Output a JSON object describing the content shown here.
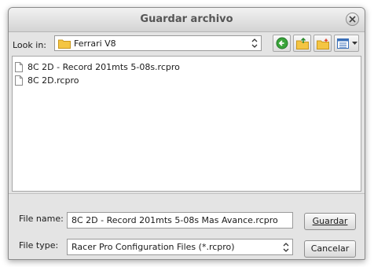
{
  "window": {
    "title": "Guardar archivo"
  },
  "toolbar": {
    "look_in_label": "Look in:",
    "current_folder": "Ferrari V8",
    "buttons": [
      "back-icon",
      "up-folder-icon",
      "new-folder-icon",
      "view-menu-icon"
    ]
  },
  "files": [
    {
      "name": "8C 2D - Record 201mts 5-08s.rcpro"
    },
    {
      "name": "8C 2D.rcpro"
    }
  ],
  "form": {
    "file_name_label": "File name:",
    "file_name_value": "8C 2D - Record 201mts 5-08s Mas Avance.rcpro",
    "file_type_label": "File type:",
    "file_type_value": "Racer Pro Configuration Files (*.rcpro)",
    "save_label": "Guardar",
    "cancel_label": "Cancelar"
  },
  "colors": {
    "back_button_green": "#3aa43a",
    "folder_yellow": "#f4c542",
    "view_blue": "#3a6fb8"
  }
}
